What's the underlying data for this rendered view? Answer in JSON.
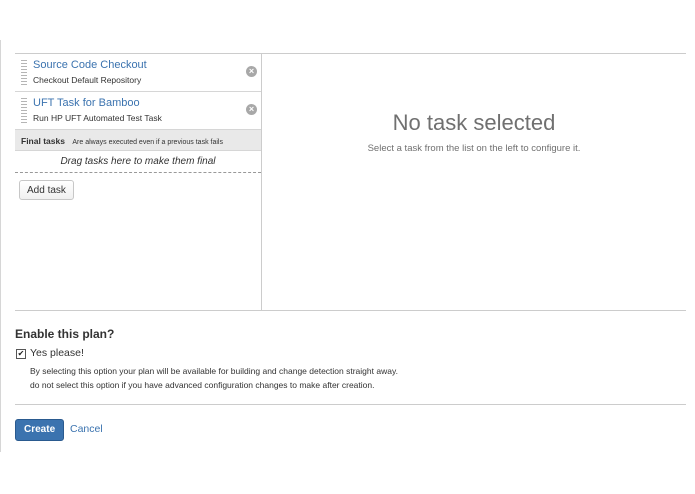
{
  "tasks": [
    {
      "title": "Source Code Checkout",
      "subtitle": "Checkout Default Repository"
    },
    {
      "title": "UFT Task for Bamboo",
      "subtitle": "Run HP UFT Automated Test Task"
    }
  ],
  "final_tasks": {
    "label": "Final tasks",
    "note": "Are always executed even if a previous task fails",
    "drop_hint": "Drag tasks here to make them final"
  },
  "add_task_label": "Add task",
  "task_panel": {
    "empty_title": "No task selected",
    "empty_subtitle": "Select a task from the list on the left to configure it."
  },
  "enable_plan": {
    "heading": "Enable this plan?",
    "checkbox_label": "Yes please!",
    "checked": true,
    "description_line1": "By selecting this option your plan will be available for building and change detection straight away.",
    "description_line2": "do not select this option if you have advanced configuration changes to make after creation."
  },
  "actions": {
    "create_label": "Create",
    "cancel_label": "Cancel"
  },
  "icons": {
    "remove": "remove-icon",
    "drag": "drag-handle-icon",
    "check": "checkmark-icon"
  },
  "colors": {
    "link": "#3b73af",
    "primary_button": "#3b73af"
  }
}
